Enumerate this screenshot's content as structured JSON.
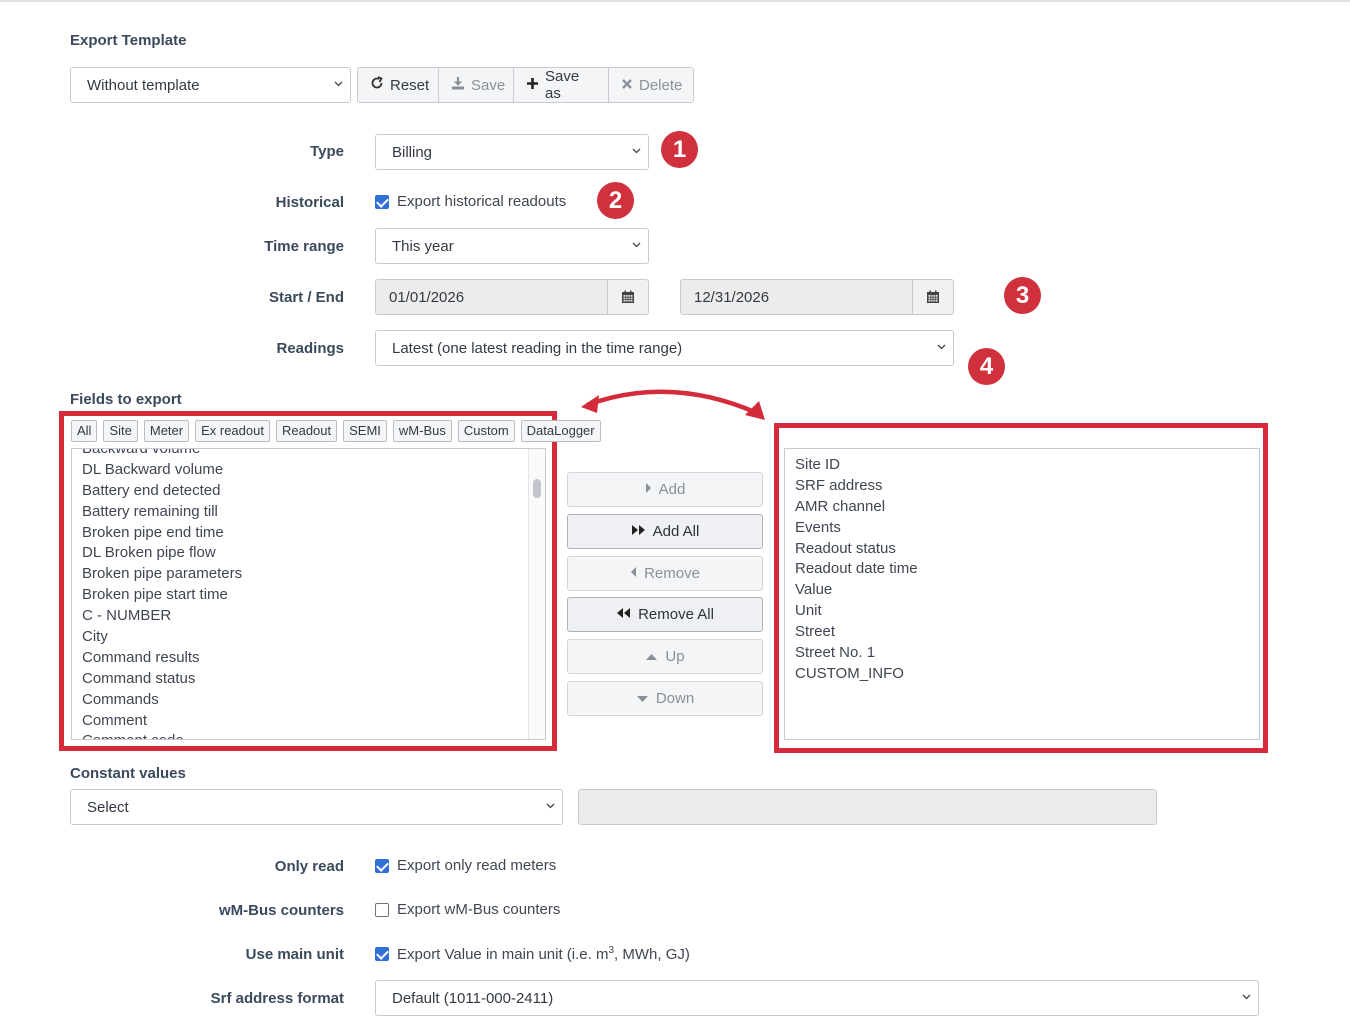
{
  "export_template": {
    "title": "Export Template",
    "template_select": "Without template",
    "buttons": {
      "reset": "Reset",
      "save": "Save",
      "save_as": "Save as",
      "delete": "Delete"
    }
  },
  "form": {
    "type_label": "Type",
    "type_value": "Billing",
    "historical_label": "Historical",
    "historical_checkbox": "Export historical readouts",
    "historical_checked": true,
    "time_range_label": "Time range",
    "time_range_value": "This year",
    "start_end_label": "Start / End",
    "start_date": "01/01/2026",
    "end_date": "12/31/2026",
    "readings_label": "Readings",
    "readings_value": "Latest (one latest reading in the time range)"
  },
  "badges": [
    "1",
    "2",
    "3",
    "4"
  ],
  "fields": {
    "title": "Fields to export",
    "filters": [
      "All",
      "Site",
      "Meter",
      "Ex readout",
      "Readout",
      "SEMI",
      "wM-Bus",
      "Custom",
      "DataLogger"
    ],
    "available": [
      "Backward volume",
      "DL Backward volume",
      "Battery end detected",
      "Battery remaining till",
      "Broken pipe end time",
      "DL Broken pipe flow",
      "Broken pipe parameters",
      "Broken pipe start time",
      "C - NUMBER",
      "City",
      "Command results",
      "Command status",
      "Commands",
      "Comment",
      "Comment code"
    ],
    "actions": {
      "add": "Add",
      "add_all": "Add All",
      "remove": "Remove",
      "remove_all": "Remove All",
      "up": "Up",
      "down": "Down"
    },
    "selected": [
      "Site ID",
      "SRF address",
      "AMR channel",
      "Events",
      "Readout status",
      "Readout date time",
      "Value",
      "Unit",
      "Street",
      "Street No. 1",
      "CUSTOM_INFO"
    ]
  },
  "constant_values": {
    "title": "Constant values",
    "select": "Select",
    "value": ""
  },
  "options": {
    "only_read_label": "Only read",
    "only_read_text": "Export only read meters",
    "only_read_checked": true,
    "wmbus_label": "wM-Bus counters",
    "wmbus_text": "Export wM-Bus counters",
    "wmbus_checked": false,
    "main_unit_label": "Use main unit",
    "main_unit_text_before": "Export Value in main unit (i.e. m",
    "main_unit_sup": "3",
    "main_unit_text_after": ", MWh, GJ)",
    "main_unit_checked": true,
    "srf_label": "Srf address format",
    "srf_value": "Default (1011-000-2411)"
  },
  "colors": {
    "accent_red": "#d42b3a",
    "badge_red": "#d0313d",
    "checkbox_blue": "#2f6fd6"
  },
  "icons": {
    "reset": "refresh-icon",
    "save": "download-icon",
    "save_as": "plus-icon",
    "delete": "x-icon",
    "calendar": "calendar-icon",
    "select_caret": "chevron-down-icon"
  }
}
